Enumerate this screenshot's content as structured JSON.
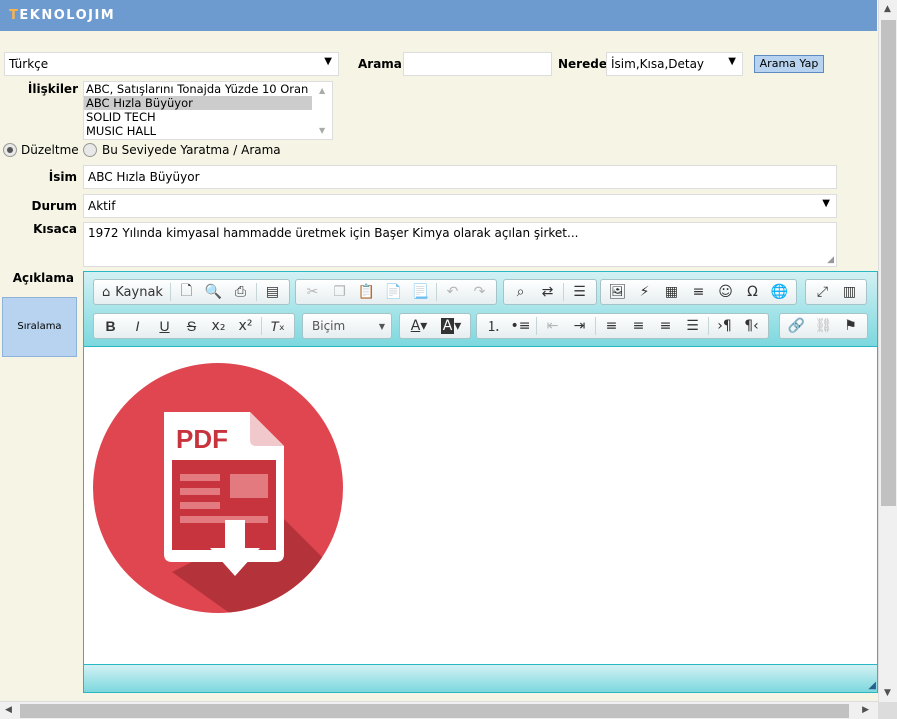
{
  "header": {
    "logo_prefix": "T",
    "logo_rest": "EKNOLOJIM"
  },
  "filters": {
    "language": "Türkçe",
    "search_label": "Arama",
    "search_value": "",
    "where_label": "Nerede",
    "where_value": "İsim,Kısa,Detay",
    "search_button": "Arama Yap"
  },
  "relations": {
    "label": "İlişkiler",
    "items": [
      {
        "label": "ABC, Satışlarını Tonajda Yüzde 10 Oran",
        "selected": false
      },
      {
        "label": "ABC Hızla Büyüyor",
        "selected": true
      },
      {
        "label": "SOLID TECH",
        "selected": false
      },
      {
        "label": "MUSIC HALL",
        "selected": false
      }
    ]
  },
  "mode": {
    "edit_label": "Düzeltme",
    "create_label": "Bu Seviyede Yaratma / Arama",
    "selected": "edit"
  },
  "form": {
    "name_label": "İsim",
    "name_value": "ABC Hızla Büyüyor",
    "status_label": "Durum",
    "status_value": "Aktif",
    "short_label": "Kısaca",
    "short_value": "1972 Yılında kimyasal hammadde üretmek için Başer Kimya olarak açılan şirket...",
    "description_label": "Açıklama",
    "sort_label": "Sıralama"
  },
  "editor": {
    "source_label": "Kaynak",
    "format_placeholder": "Biçim",
    "image_text": "PDF",
    "colors": {
      "accent": "#29b8c3",
      "pdf_red": "#e0464f",
      "pdf_dark": "#b4333b"
    }
  }
}
